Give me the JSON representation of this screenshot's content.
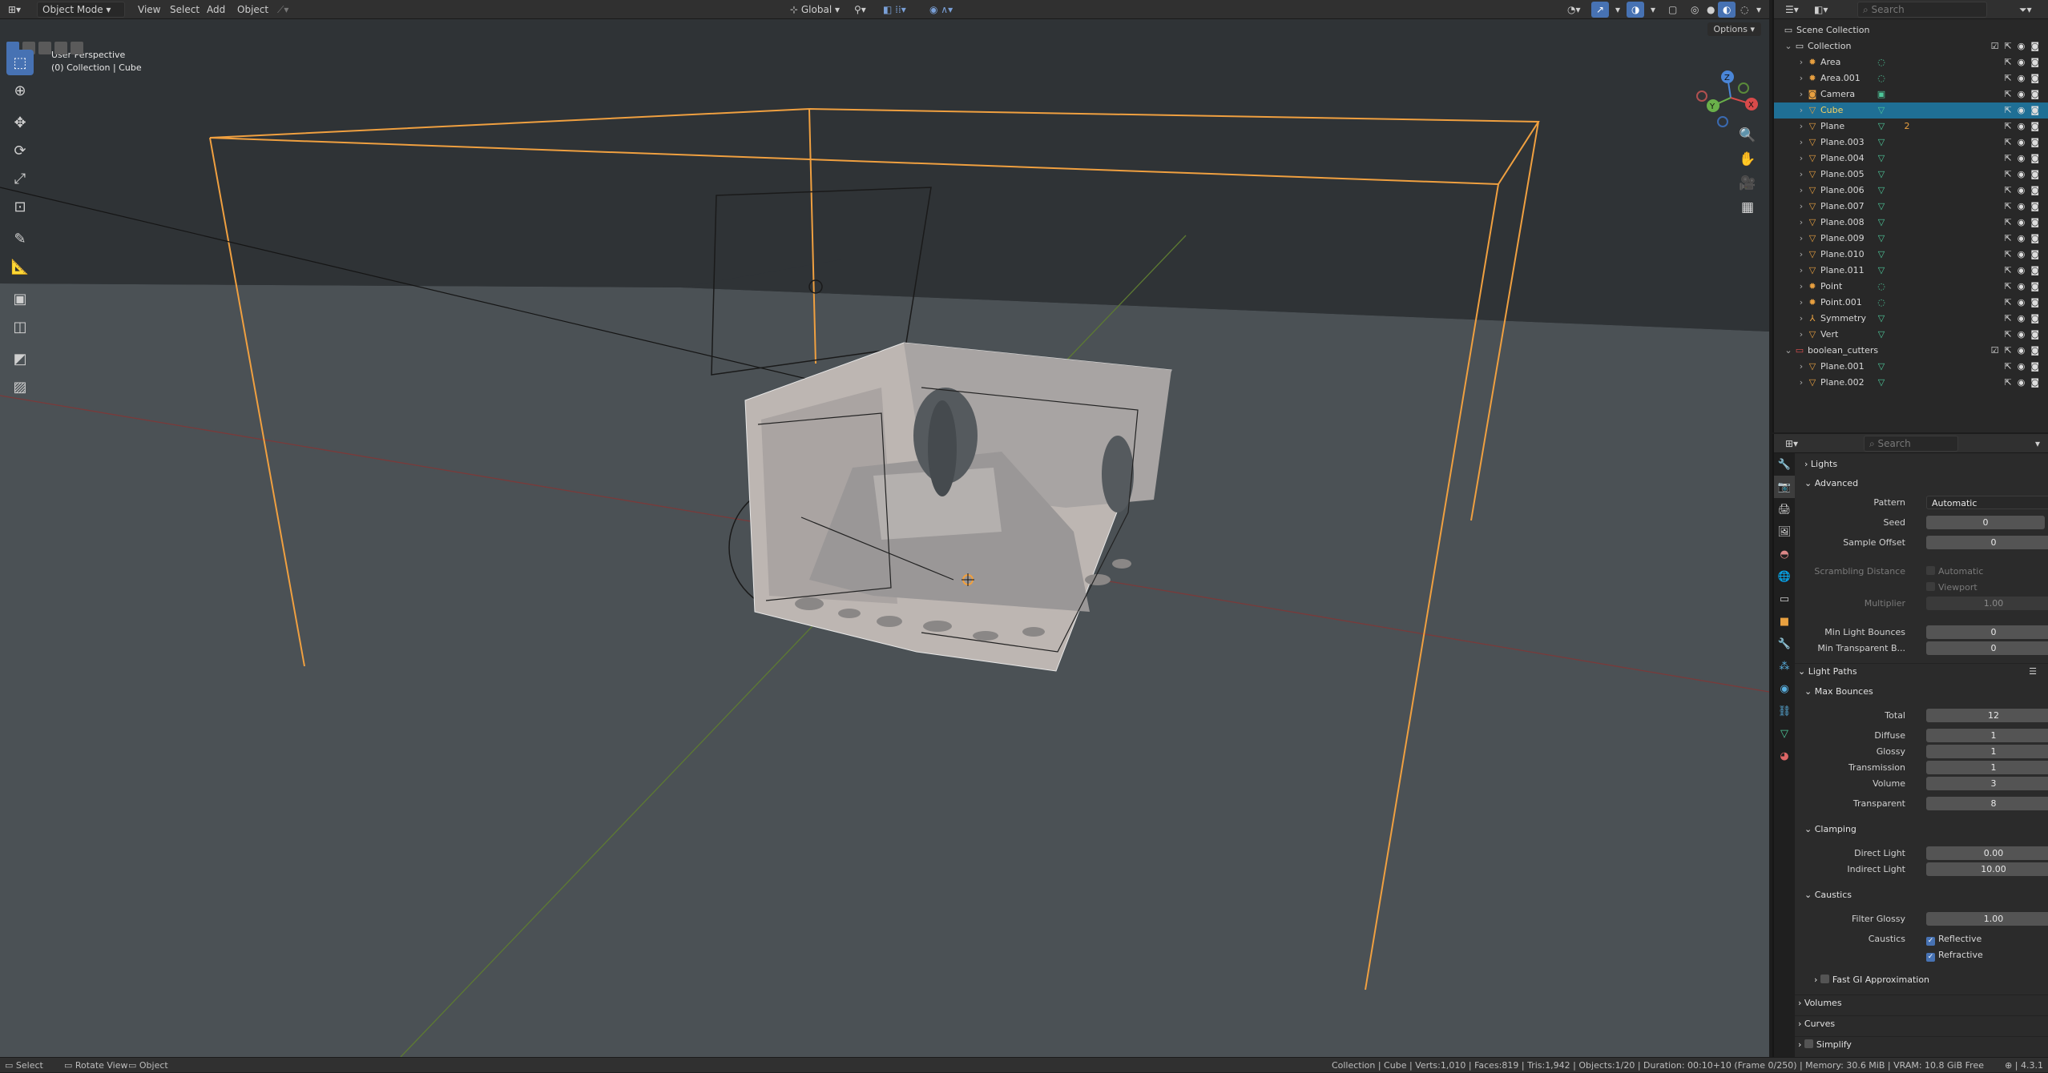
{
  "header": {
    "mode": "Object Mode",
    "menus": [
      "View",
      "Select",
      "Add",
      "Object"
    ],
    "transform_orientation": "Global",
    "options_label": "Options"
  },
  "viewport": {
    "perspective_label": "User Perspective",
    "collection_label": "(0) Collection | Cube",
    "gizmo_axes": [
      "Z",
      "Y",
      "X"
    ]
  },
  "outliner": {
    "search_placeholder": "Search",
    "root": "Scene Collection",
    "items": [
      {
        "name": "Collection",
        "type": "collection"
      },
      {
        "name": "Area",
        "type": "light"
      },
      {
        "name": "Area.001",
        "type": "light"
      },
      {
        "name": "Camera",
        "type": "camera"
      },
      {
        "name": "Cube",
        "type": "mesh",
        "selected": true
      },
      {
        "name": "Plane",
        "type": "mesh",
        "badge": "2"
      },
      {
        "name": "Plane.003",
        "type": "mesh"
      },
      {
        "name": "Plane.004",
        "type": "mesh"
      },
      {
        "name": "Plane.005",
        "type": "mesh"
      },
      {
        "name": "Plane.006",
        "type": "mesh"
      },
      {
        "name": "Plane.007",
        "type": "mesh"
      },
      {
        "name": "Plane.008",
        "type": "mesh"
      },
      {
        "name": "Plane.009",
        "type": "mesh"
      },
      {
        "name": "Plane.010",
        "type": "mesh"
      },
      {
        "name": "Plane.011",
        "type": "mesh"
      },
      {
        "name": "Point",
        "type": "light"
      },
      {
        "name": "Point.001",
        "type": "light"
      },
      {
        "name": "Symmetry",
        "type": "empty"
      },
      {
        "name": "Vert",
        "type": "mesh"
      },
      {
        "name": "boolean_cutters",
        "type": "collection"
      },
      {
        "name": "Plane.001",
        "type": "mesh"
      },
      {
        "name": "Plane.002",
        "type": "mesh"
      }
    ]
  },
  "properties": {
    "search_placeholder": "Search",
    "lights_label": "Lights",
    "advanced_label": "Advanced",
    "pattern_label": "Pattern",
    "pattern_value": "Automatic",
    "seed_label": "Seed",
    "seed_value": "0",
    "sample_offset_label": "Sample Offset",
    "sample_offset_value": "0",
    "scrambling_label": "Scrambling Distance",
    "scrambling_automatic": "Automatic",
    "scrambling_viewport": "Viewport",
    "multiplier_label": "Multiplier",
    "multiplier_value": "1.00",
    "min_light_bounces_label": "Min Light Bounces",
    "min_light_bounces_value": "0",
    "min_transparent_label": "Min Transparent B...",
    "min_transparent_value": "0",
    "light_paths_label": "Light Paths",
    "max_bounces_label": "Max Bounces",
    "total_label": "Total",
    "total_value": "12",
    "diffuse_label": "Diffuse",
    "diffuse_value": "1",
    "glossy_label": "Glossy",
    "glossy_value": "1",
    "transmission_label": "Transmission",
    "transmission_value": "1",
    "volume_label": "Volume",
    "volume_value": "3",
    "transparent_label": "Transparent",
    "transparent_value": "8",
    "clamping_label": "Clamping",
    "direct_light_label": "Direct Light",
    "direct_light_value": "0.00",
    "indirect_light_label": "Indirect Light",
    "indirect_light_value": "10.00",
    "caustics_label": "Caustics",
    "filter_glossy_label": "Filter Glossy",
    "filter_glossy_value": "1.00",
    "caustics_row_label": "Caustics",
    "reflective_label": "Reflective",
    "refractive_label": "Refractive",
    "fast_gi_label": "Fast GI Approximation",
    "volumes_label": "Volumes",
    "curves_label": "Curves",
    "simplify_label": "Simplify"
  },
  "statusbar": {
    "select": "Select",
    "rotate": "Rotate View",
    "object": "Object",
    "stats": "Collection | Cube | Verts:1,010 | Faces:819 | Tris:1,942 | Objects:1/20 | Duration: 00:10+10 (Frame 0/250) | Memory: 30.6 MiB | VRAM: 10.8 GiB Free",
    "version": "4.3.1"
  },
  "colors": {
    "accent": "#4772b3",
    "selection": "#1f6f95",
    "light_outline": "#f0a040",
    "mesh_icon": "#e0a040",
    "modifier_icon": "#5ab0e0",
    "data_icon": "#4ec89a"
  }
}
